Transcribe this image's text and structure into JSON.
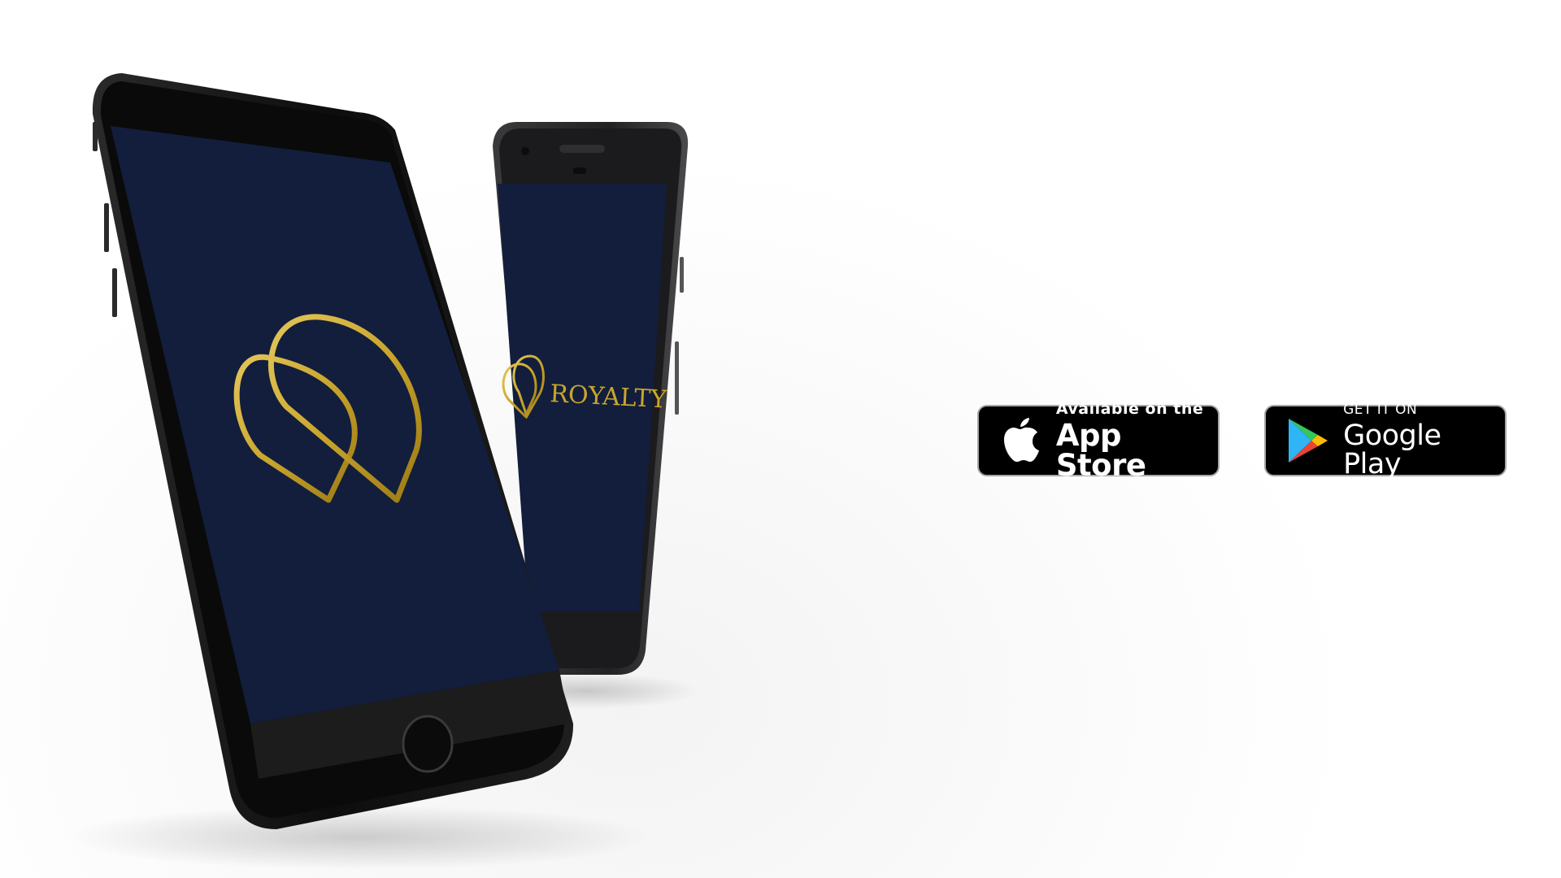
{
  "colors": {
    "screen": "#121e3c",
    "gold": "#c9a52c",
    "phone_body": "#111111",
    "badge_bg": "#000000",
    "badge_border": "#a6a6a6"
  },
  "left_phone": {
    "model": "iphone",
    "screen_content": "logo-mark"
  },
  "right_phone": {
    "model": "android",
    "brand_text": "ROYALTY"
  },
  "badges": {
    "appstore": {
      "icon": "apple-icon",
      "small_text": "Available on the",
      "big_text": "App Store"
    },
    "googleplay": {
      "icon": "google-play-icon",
      "small_text": "GET IT ON",
      "big_text": "Google Play"
    }
  }
}
